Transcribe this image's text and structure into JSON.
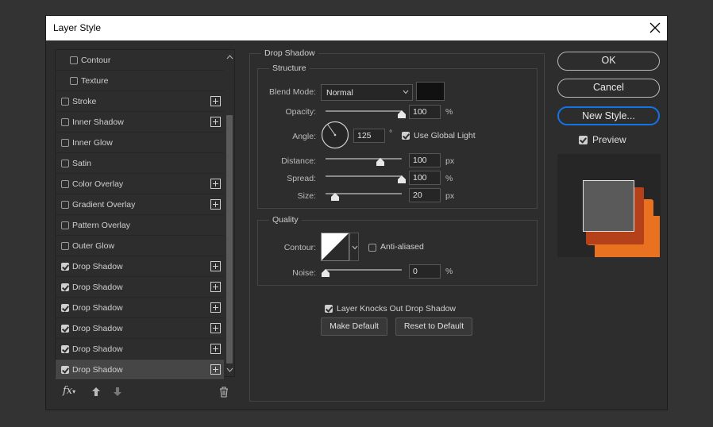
{
  "window": {
    "title": "Layer Style"
  },
  "style_list": [
    {
      "label": "Contour",
      "checked": false,
      "indent": true,
      "plus": false
    },
    {
      "label": "Texture",
      "checked": false,
      "indent": true,
      "plus": false
    },
    {
      "label": "Stroke",
      "checked": false,
      "indent": false,
      "plus": true
    },
    {
      "label": "Inner Shadow",
      "checked": false,
      "indent": false,
      "plus": true
    },
    {
      "label": "Inner Glow",
      "checked": false,
      "indent": false,
      "plus": false
    },
    {
      "label": "Satin",
      "checked": false,
      "indent": false,
      "plus": false
    },
    {
      "label": "Color Overlay",
      "checked": false,
      "indent": false,
      "plus": true
    },
    {
      "label": "Gradient Overlay",
      "checked": false,
      "indent": false,
      "plus": true
    },
    {
      "label": "Pattern Overlay",
      "checked": false,
      "indent": false,
      "plus": false
    },
    {
      "label": "Outer Glow",
      "checked": false,
      "indent": false,
      "plus": false
    },
    {
      "label": "Drop Shadow",
      "checked": true,
      "indent": false,
      "plus": true
    },
    {
      "label": "Drop Shadow",
      "checked": true,
      "indent": false,
      "plus": true
    },
    {
      "label": "Drop Shadow",
      "checked": true,
      "indent": false,
      "plus": true
    },
    {
      "label": "Drop Shadow",
      "checked": true,
      "indent": false,
      "plus": true
    },
    {
      "label": "Drop Shadow",
      "checked": true,
      "indent": false,
      "plus": true
    },
    {
      "label": "Drop Shadow",
      "checked": true,
      "indent": false,
      "plus": true,
      "selected": true
    }
  ],
  "panel": {
    "section_title": "Drop Shadow",
    "structure_title": "Structure",
    "blend_mode_label": "Blend Mode:",
    "blend_mode_value": "Normal",
    "shadow_color": "#111111",
    "opacity_label": "Opacity:",
    "opacity_value": "100",
    "opacity_unit": "%",
    "opacity_fraction": 1.0,
    "angle_label": "Angle:",
    "angle_value": "125",
    "angle_unit": "°",
    "use_global_light_label": "Use Global Light",
    "use_global_light": true,
    "distance_label": "Distance:",
    "distance_value": "100",
    "distance_unit": "px",
    "distance_fraction": 0.72,
    "spread_label": "Spread:",
    "spread_value": "100",
    "spread_unit": "%",
    "spread_fraction": 1.0,
    "size_label": "Size:",
    "size_value": "20",
    "size_unit": "px",
    "size_fraction": 0.13,
    "quality_title": "Quality",
    "contour_label": "Contour:",
    "anti_aliased_label": "Anti-aliased",
    "anti_aliased": false,
    "noise_label": "Noise:",
    "noise_value": "0",
    "noise_unit": "%",
    "noise_fraction": 0.0,
    "knockout_label": "Layer Knocks Out Drop Shadow",
    "knockout": true,
    "make_default_label": "Make Default",
    "reset_default_label": "Reset to Default"
  },
  "actions": {
    "ok_label": "OK",
    "cancel_label": "Cancel",
    "new_style_label": "New Style...",
    "preview_label": "Preview",
    "preview_checked": true
  },
  "colors": {
    "accent_focus": "#1473e6",
    "preview_shadow_dark": "#b5411a",
    "preview_shadow_light": "#e8721f",
    "preview_square": "#5a5a5a"
  },
  "icons": [
    "close-icon",
    "fx-icon",
    "move-up-icon",
    "move-down-icon",
    "trash-icon",
    "scroll-up-icon",
    "scroll-down-icon",
    "chevron-down-icon",
    "contour-curve-icon",
    "angle-dial-icon"
  ]
}
